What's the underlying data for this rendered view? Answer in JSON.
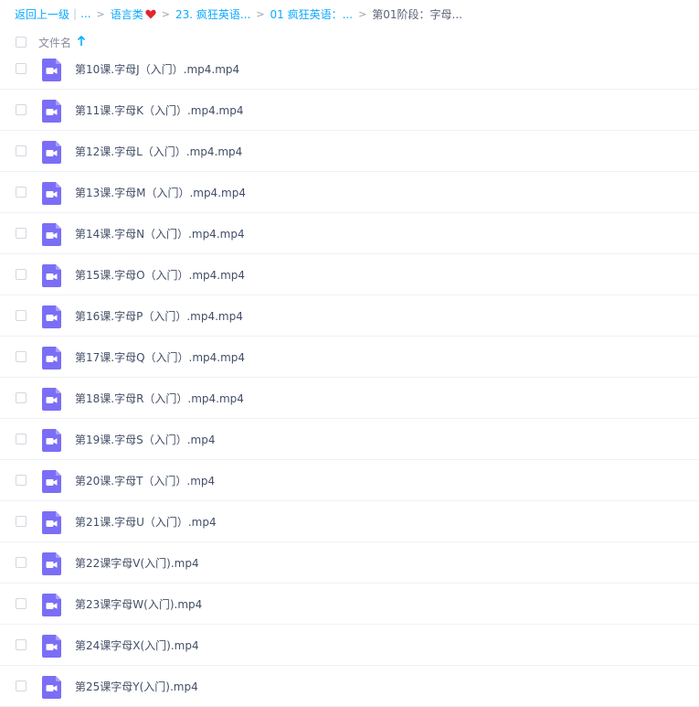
{
  "breadcrumb": {
    "back": "返回上一级",
    "ellipsis": "...",
    "level1": "语言类",
    "level2": "23. 疯狂英语...",
    "level3": "01 疯狂英语：...",
    "current": "第01阶段：字母..."
  },
  "header": {
    "column_name": "文件名"
  },
  "files": [
    "第10课.字母J（入门）.mp4.mp4",
    "第11课.字母K（入门）.mp4.mp4",
    "第12课.字母L（入门）.mp4.mp4",
    "第13课.字母M（入门）.mp4.mp4",
    "第14课.字母N（入门）.mp4.mp4",
    "第15课.字母O（入门）.mp4.mp4",
    "第16课.字母P（入门）.mp4.mp4",
    "第17课.字母Q（入门）.mp4.mp4",
    "第18课.字母R（入门）.mp4.mp4",
    "第19课.字母S（入门）.mp4",
    "第20课.字母T（入门）.mp4",
    "第21课.字母U（入门）.mp4",
    "第22课字母V(入门).mp4",
    "第23课字母W(入门).mp4",
    "第24课字母X(入门).mp4",
    "第25课字母Y(入门).mp4"
  ],
  "icons": {
    "file": "video-file-icon",
    "sort": "sort-ascending-icon",
    "heart": "heart-icon"
  },
  "colors": {
    "link": "#09aaff",
    "video_icon": "#7b6ef6",
    "heart": "#e0262e"
  }
}
